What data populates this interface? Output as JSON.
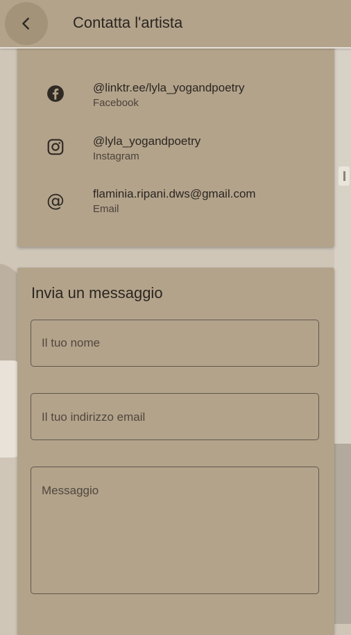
{
  "header": {
    "title": "Contatta l'artista",
    "back_icon": "chevron-left-icon"
  },
  "contacts": [
    {
      "icon": "facebook-icon",
      "value": "@linktr.ee/lyla_yogandpoetry",
      "type": "Facebook"
    },
    {
      "icon": "instagram-icon",
      "value": "@lyla_yogandpoetry",
      "type": "Instagram"
    },
    {
      "icon": "at-sign-icon",
      "value": "flaminia.ripani.dws@gmail.com",
      "type": "Email"
    }
  ],
  "form": {
    "title": "Invia un messaggio",
    "name_placeholder": "Il tuo nome",
    "email_placeholder": "Il tuo indirizzo email",
    "message_placeholder": "Messaggio"
  },
  "colors": {
    "card": "#b3a38b",
    "text": "#2b2620",
    "background": "#cfc6b8"
  }
}
